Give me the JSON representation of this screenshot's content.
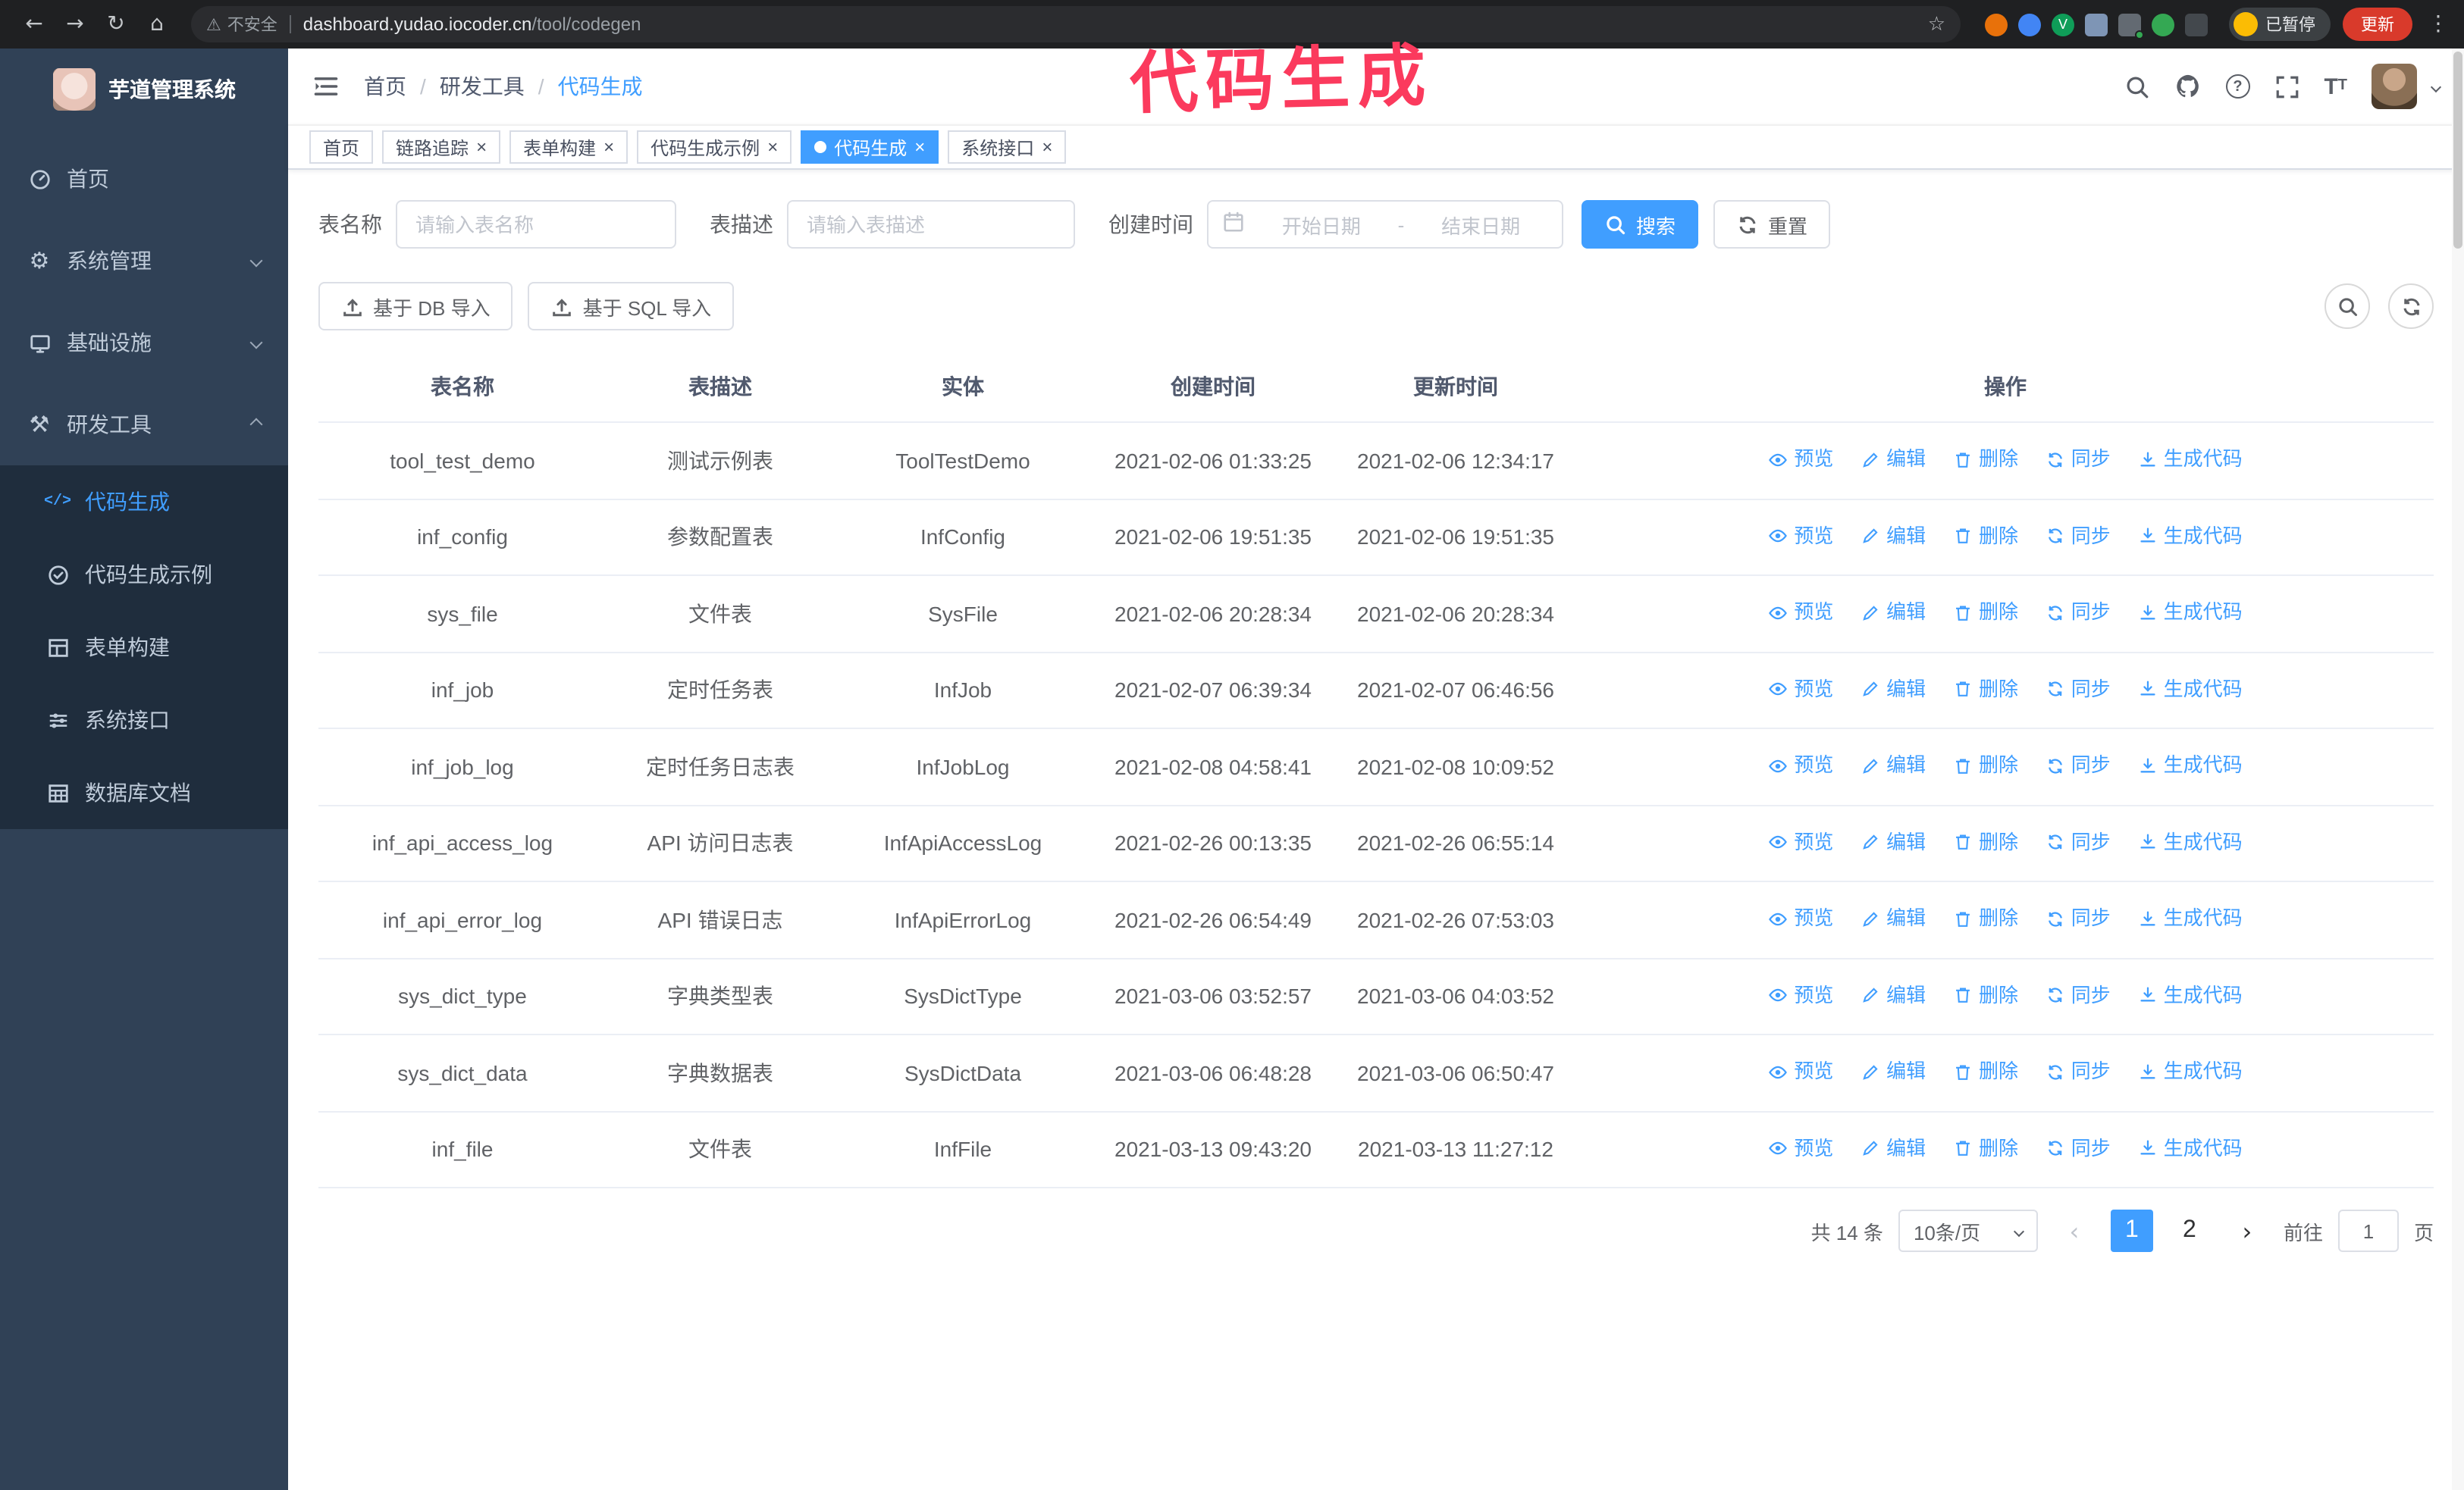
{
  "colors": {
    "accent": "#409eff",
    "sidebar_bg": "#304156",
    "submenu_bg": "#1f2d3d",
    "annotation": "#fb3a5d",
    "update_button": "#d93a2b",
    "chrome_bg": "#1f2022"
  },
  "annotation": {
    "text": "代码生成"
  },
  "browser": {
    "security_label": "不安全",
    "url_host": "dashboard.yudao.iocoder.cn",
    "url_path": "/tool/codegen",
    "profile_badge": "已暂停",
    "update_button": "更新"
  },
  "sidebar": {
    "app_title": "芋道管理系统",
    "items": [
      {
        "label": "首页"
      },
      {
        "label": "系统管理"
      },
      {
        "label": "基础设施"
      },
      {
        "label": "研发工具"
      }
    ],
    "submenu": [
      {
        "label": "代码生成"
      },
      {
        "label": "代码生成示例"
      },
      {
        "label": "表单构建"
      },
      {
        "label": "系统接口"
      },
      {
        "label": "数据库文档"
      }
    ]
  },
  "navbar": {
    "breadcrumb": [
      "首页",
      "研发工具",
      "代码生成"
    ],
    "breadcrumb_separator": "/"
  },
  "tags": [
    {
      "label": "首页"
    },
    {
      "label": "链路追踪"
    },
    {
      "label": "表单构建"
    },
    {
      "label": "代码生成示例"
    },
    {
      "label": "代码生成"
    },
    {
      "label": "系统接口"
    }
  ],
  "filters": {
    "name_label": "表名称",
    "name_placeholder": "请输入表名称",
    "desc_label": "表描述",
    "desc_placeholder": "请输入表描述",
    "time_label": "创建时间",
    "start_placeholder": "开始日期",
    "range_separator": "-",
    "end_placeholder": "结束日期",
    "search_button": "搜索",
    "reset_button": "重置"
  },
  "toolbar": {
    "import_db": "基于 DB 导入",
    "import_sql": "基于 SQL 导入"
  },
  "table": {
    "columns": [
      "表名称",
      "表描述",
      "实体",
      "创建时间",
      "更新时间",
      "操作"
    ],
    "action_labels": [
      "预览",
      "编辑",
      "删除",
      "同步",
      "生成代码"
    ],
    "rows": [
      {
        "name": "tool_test_demo",
        "desc": "测试示例表",
        "entity": "ToolTestDemo",
        "created": "2021-02-06 01:33:25",
        "updated": "2021-02-06 12:34:17"
      },
      {
        "name": "inf_config",
        "desc": "参数配置表",
        "entity": "InfConfig",
        "created": "2021-02-06 19:51:35",
        "updated": "2021-02-06 19:51:35"
      },
      {
        "name": "sys_file",
        "desc": "文件表",
        "entity": "SysFile",
        "created": "2021-02-06 20:28:34",
        "updated": "2021-02-06 20:28:34"
      },
      {
        "name": "inf_job",
        "desc": "定时任务表",
        "entity": "InfJob",
        "created": "2021-02-07 06:39:34",
        "updated": "2021-02-07 06:46:56"
      },
      {
        "name": "inf_job_log",
        "desc": "定时任务日志表",
        "entity": "InfJobLog",
        "created": "2021-02-08 04:58:41",
        "updated": "2021-02-08 10:09:52"
      },
      {
        "name": "inf_api_access_log",
        "desc": "API 访问日志表",
        "entity": "InfApiAccessLog",
        "created": "2021-02-26 00:13:35",
        "updated": "2021-02-26 06:55:14"
      },
      {
        "name": "inf_api_error_log",
        "desc": "API 错误日志",
        "entity": "InfApiErrorLog",
        "created": "2021-02-26 06:54:49",
        "updated": "2021-02-26 07:53:03"
      },
      {
        "name": "sys_dict_type",
        "desc": "字典类型表",
        "entity": "SysDictType",
        "created": "2021-03-06 03:52:57",
        "updated": "2021-03-06 04:03:52"
      },
      {
        "name": "sys_dict_data",
        "desc": "字典数据表",
        "entity": "SysDictData",
        "created": "2021-03-06 06:48:28",
        "updated": "2021-03-06 06:50:47"
      },
      {
        "name": "inf_file",
        "desc": "文件表",
        "entity": "InfFile",
        "created": "2021-03-13 09:43:20",
        "updated": "2021-03-13 11:27:12"
      }
    ]
  },
  "pagination": {
    "total": "共 14 条",
    "page_size": "10条/页",
    "pages": [
      "1",
      "2"
    ],
    "goto_label": "前往",
    "goto_value": "1",
    "goto_unit": "页"
  }
}
